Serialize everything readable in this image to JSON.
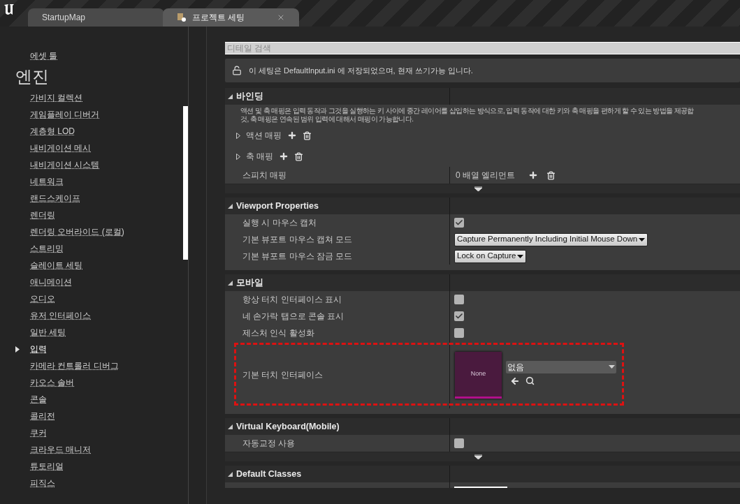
{
  "tabs": [
    {
      "label": "StartupMap",
      "selected": false,
      "closable": false
    },
    {
      "label": "프로젝트 세팅",
      "selected": true,
      "closable": true
    }
  ],
  "sidebar": {
    "top_item": "에셋 툴",
    "section_title": "엔진",
    "items": [
      {
        "label": "가비지 컬렉션",
        "selected": false
      },
      {
        "label": "게임플레이 디버거",
        "selected": false
      },
      {
        "label": "계층형 LOD",
        "selected": false
      },
      {
        "label": "내비게이션 메시",
        "selected": false
      },
      {
        "label": "내비게이션 시스템",
        "selected": false
      },
      {
        "label": "네트워크",
        "selected": false
      },
      {
        "label": "랜드스케이프",
        "selected": false
      },
      {
        "label": "렌더링",
        "selected": false
      },
      {
        "label": "렌더링 오버라이드 (로컬)",
        "selected": false
      },
      {
        "label": "스트리밍",
        "selected": false
      },
      {
        "label": "슬레이트 세팅",
        "selected": false
      },
      {
        "label": "애니메이션",
        "selected": false
      },
      {
        "label": "오디오",
        "selected": false
      },
      {
        "label": "유저 인터페이스",
        "selected": false
      },
      {
        "label": "일반 세팅",
        "selected": false
      },
      {
        "label": "입력",
        "selected": true
      },
      {
        "label": "카메라 컨트롤러 디버그",
        "selected": false
      },
      {
        "label": "카오스 솔버",
        "selected": false
      },
      {
        "label": "콘솔",
        "selected": false
      },
      {
        "label": "콜리전",
        "selected": false
      },
      {
        "label": "쿠커",
        "selected": false
      },
      {
        "label": "크라우드 매니저",
        "selected": false
      },
      {
        "label": "튜토리얼",
        "selected": false
      },
      {
        "label": "피직스",
        "selected": false
      }
    ]
  },
  "details": {
    "search": {
      "placeholder": "디테일 검색"
    },
    "info": "이 세팅은 DefaultInput.ini 에 저장되었으며, 현재 쓰기가능 입니다.",
    "categories": [
      {
        "title": "바인딩",
        "expanded": true,
        "has_more": true,
        "description": [
          "액션 및 축 매핑은 입력 동작과 그것을 실행하는 키 사이에 중간 레이어를 삽입하는 방식으로, 입력 동작에 대한 키와 축 매핑을 편하게 할 수 있는 방법을 제공합",
          "것, 축 매핑은 연속된 범위 입력에 대해서 매핑이 가능합니다."
        ],
        "rows": [
          {
            "kind": "group",
            "label": "액션 매핑",
            "expanded": false
          },
          {
            "kind": "group",
            "label": "축 매핑",
            "expanded": false
          },
          {
            "kind": "array",
            "label": "스피치 매핑",
            "value": "0 배열 엘리먼트"
          }
        ]
      },
      {
        "title": "Viewport Properties",
        "expanded": true,
        "has_more": false,
        "rows": [
          {
            "kind": "checkbox",
            "label": "실행 시 마우스 캡처",
            "checked": true
          },
          {
            "kind": "dropdown",
            "label": "기본 뷰포트 마우스 캡쳐 모드",
            "value": "Capture Permanently Including Initial Mouse Down"
          },
          {
            "kind": "dropdown",
            "label": "기본 뷰포트 마우스 잠금 모드",
            "value": "Lock on Capture"
          }
        ]
      },
      {
        "title": "모바일",
        "expanded": true,
        "has_more": false,
        "rows": [
          {
            "kind": "checkbox",
            "label": "항상 터치 인터페이스 표시",
            "checked": false
          },
          {
            "kind": "checkbox",
            "label": "네 손가락 탭으로 콘솔 표시",
            "checked": true
          },
          {
            "kind": "checkbox",
            "label": "제스처 인식 활성화",
            "checked": false
          },
          {
            "kind": "asset",
            "label": "기본 터치 인터페이스",
            "thumbnail": "None",
            "value": "없음",
            "highlighted": true
          }
        ]
      },
      {
        "title": "Virtual Keyboard(Mobile)",
        "expanded": true,
        "has_more": true,
        "rows": [
          {
            "kind": "checkbox",
            "label": "자동교정 사용",
            "checked": false
          }
        ]
      },
      {
        "title": "Default Classes",
        "expanded": true,
        "has_more": false
      }
    ]
  }
}
